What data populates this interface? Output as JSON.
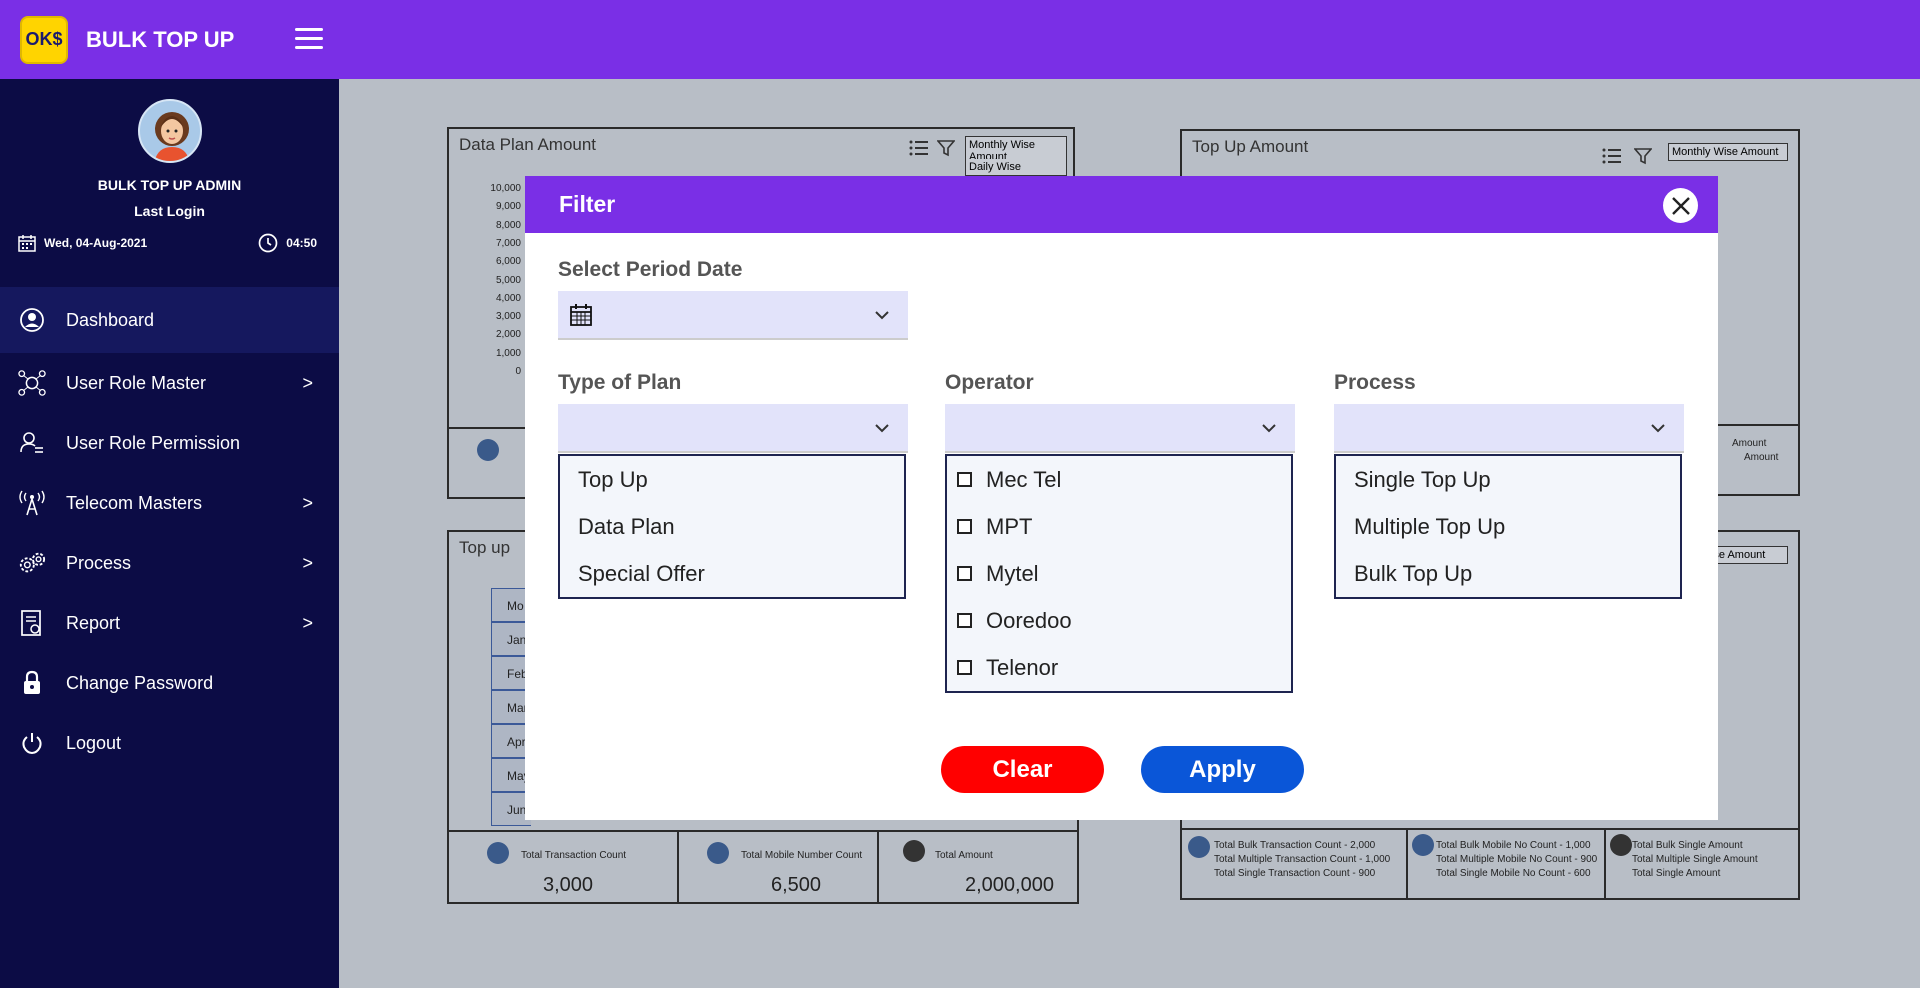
{
  "brand": {
    "logo_text": "OK$",
    "title": "BULK TOP UP"
  },
  "profile": {
    "name": "BULK TOP UP ADMIN",
    "last_login_label": "Last Login",
    "date": "Wed, 04-Aug-2021",
    "time": "04:50"
  },
  "nav": {
    "items": [
      {
        "label": "Dashboard",
        "icon": "user-circle-icon",
        "has_submenu": false,
        "active": true
      },
      {
        "label": "User Role Master",
        "icon": "network-icon",
        "has_submenu": true
      },
      {
        "label": "User Role Permission",
        "icon": "user-list-icon",
        "has_submenu": false
      },
      {
        "label": "Telecom Masters",
        "icon": "tower-icon",
        "has_submenu": true
      },
      {
        "label": "Process",
        "icon": "gears-icon",
        "has_submenu": true
      },
      {
        "label": "Report",
        "icon": "report-icon",
        "has_submenu": true
      },
      {
        "label": "Change Password",
        "icon": "lock-icon",
        "has_submenu": false
      },
      {
        "label": "Logout",
        "icon": "power-icon",
        "has_submenu": false
      }
    ]
  },
  "background": {
    "data_plan_card": {
      "title": "Data Plan Amount",
      "select": "Monthly Wise Amount",
      "select_option": "Daily Wise",
      "y_ticks": [
        "10,000",
        "9,000",
        "8,000",
        "7,000",
        "6,000",
        "5,000",
        "4,000",
        "3,000",
        "2,000",
        "1,000",
        "0"
      ]
    },
    "top_up_card": {
      "title": "Top Up Amount",
      "select": "Monthly Wise Amount",
      "footer_lines": [
        "Amount",
        "Amount"
      ]
    },
    "top_up_table_card": {
      "title": "Top up",
      "rows": [
        "Mo",
        "Jan",
        "Feb",
        "Mar",
        "Apr",
        "May",
        "Jun"
      ],
      "stats": [
        {
          "label": "Total Transaction Count",
          "value": "3,000"
        },
        {
          "label": "Total Mobile Number Count",
          "value": "6,500"
        },
        {
          "label": "Total Amount",
          "value": "2,000,000"
        }
      ]
    },
    "right_bottom_card": {
      "select": "y Wise Amount",
      "col1": [
        "Total Bulk  Transaction Count    - 2,000",
        "Total Multiple  Transaction Count - 1,000",
        "Total Single  Transaction Count   -   900"
      ],
      "col2": [
        "Total Bulk  Mobile No Count   - 1,000",
        "Total Multiple  Mobile No Count - 900",
        "Total Single  Mobile No Count   - 600"
      ],
      "col3": [
        "Total Bulk Single  Amount",
        "Total Multiple Single  Amount",
        "Total Single  Amount"
      ]
    }
  },
  "modal": {
    "title": "Filter",
    "period_label": "Select Period Date",
    "type_of_plan": {
      "label": "Type of Plan",
      "options": [
        "Top Up",
        "Data Plan",
        "Special Offer"
      ]
    },
    "operator": {
      "label": "Operator",
      "options": [
        "Mec Tel",
        "MPT",
        "Mytel",
        "Ooredoo",
        "Telenor"
      ]
    },
    "process": {
      "label": "Process",
      "options": [
        "Single Top Up",
        "Multiple Top Up",
        "Bulk Top Up"
      ]
    },
    "clear_label": "Clear",
    "apply_label": "Apply"
  },
  "colors": {
    "brand_purple": "#7a2fe6",
    "sidebar_bg": "#0c0c45",
    "clear_red": "#ff0000",
    "apply_blue": "#0a56d8",
    "dropdown_bg": "#e2e3fa"
  }
}
